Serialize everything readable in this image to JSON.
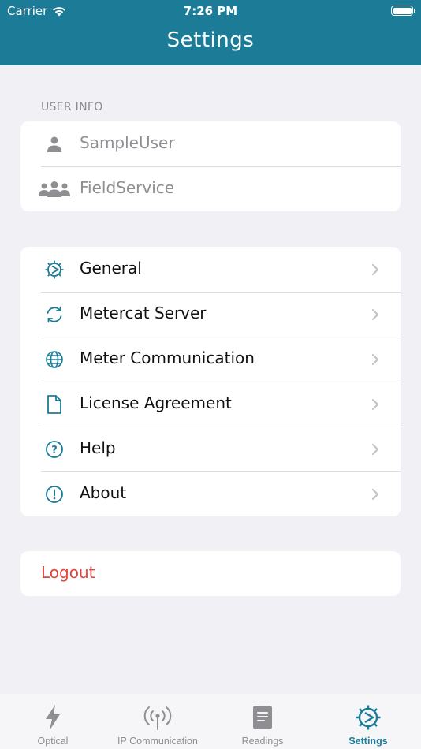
{
  "status_bar": {
    "carrier": "Carrier",
    "time": "7:26 PM"
  },
  "header": {
    "title": "Settings"
  },
  "user_info": {
    "label": "USER INFO",
    "username": "SampleUser",
    "group": "FieldService"
  },
  "menu": {
    "items": [
      {
        "label": "General",
        "icon": "gear-icon"
      },
      {
        "label": "Metercat Server",
        "icon": "sync-icon"
      },
      {
        "label": "Meter Communication",
        "icon": "globe-icon"
      },
      {
        "label": "License Agreement",
        "icon": "document-icon"
      },
      {
        "label": "Help",
        "icon": "question-circle-icon"
      },
      {
        "label": "About",
        "icon": "exclamation-circle-icon"
      }
    ]
  },
  "logout": {
    "label": "Logout",
    "color": "#e0453b"
  },
  "tabbar": {
    "tabs": [
      {
        "label": "Optical",
        "icon": "lightning-icon"
      },
      {
        "label": "IP Communication",
        "icon": "antenna-icon"
      },
      {
        "label": "Readings",
        "icon": "readings-icon"
      },
      {
        "label": "Settings",
        "icon": "gear-icon",
        "active": true
      }
    ]
  },
  "colors": {
    "accent": "#1c7b96",
    "background": "#f1f1f5",
    "muted": "#8e8e93"
  }
}
